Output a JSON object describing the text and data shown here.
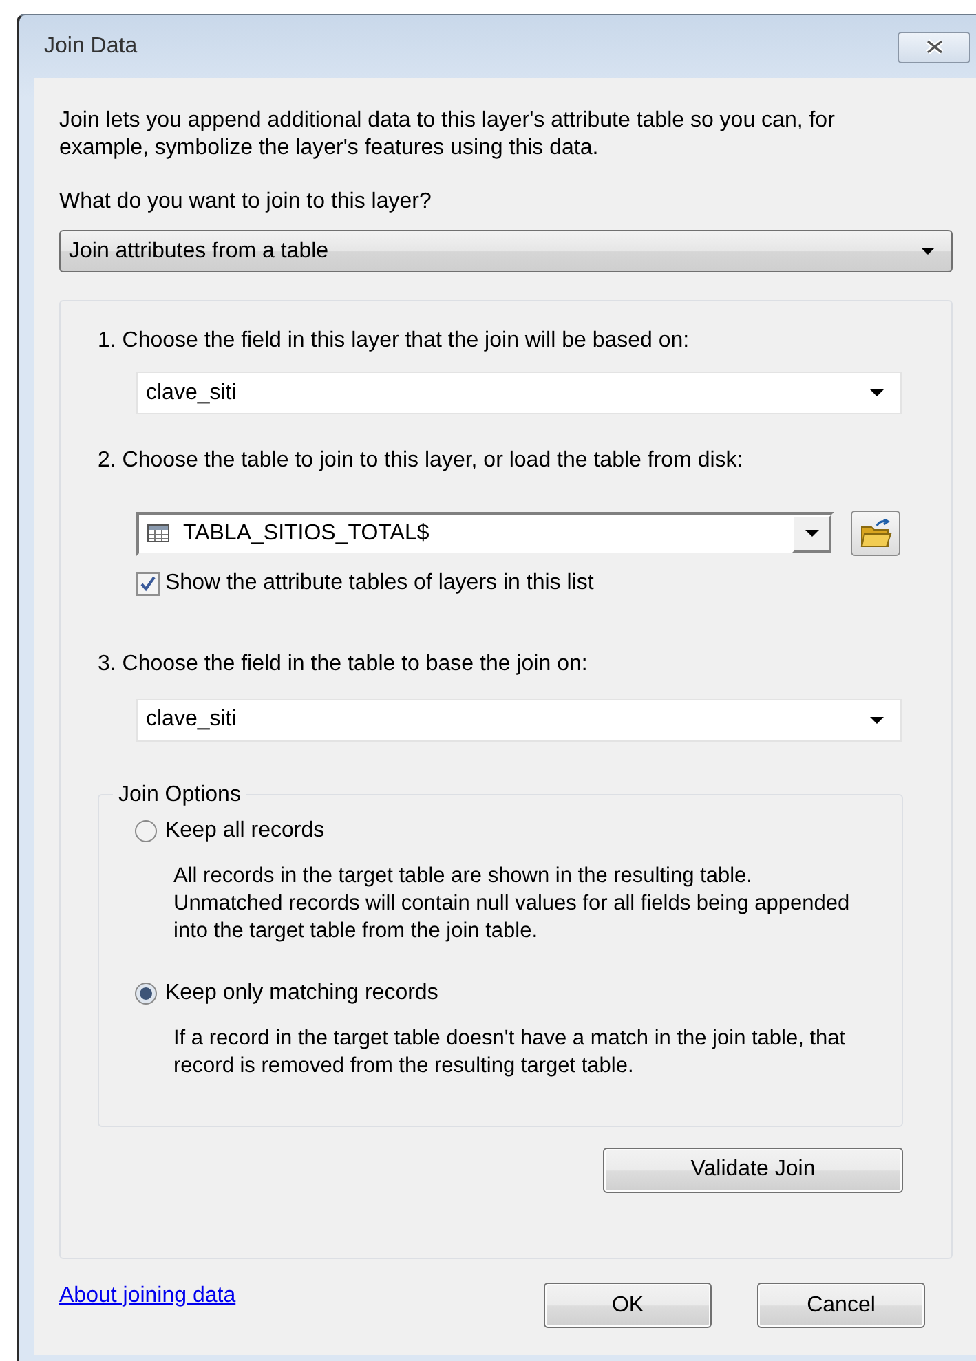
{
  "window": {
    "title": "Join Data"
  },
  "intro": "Join lets you append additional data to this layer's attribute table so you can, for example, symbolize the layer's features using this data.",
  "join_type": {
    "label": "What do you want to join to this layer?",
    "value": "Join attributes from a table"
  },
  "steps": [
    {
      "kind": "field",
      "label": "1. Choose the field in this layer that the join will be based on:",
      "value": "clave_siti"
    },
    {
      "kind": "table",
      "label": "2. Choose the table to join to this layer, or load the table from disk:",
      "value": "TABLA_SITIOS_TOTAL$",
      "checkbox": {
        "label": "Show the attribute tables of layers in this list",
        "checked": true
      }
    },
    {
      "kind": "field",
      "label": "3. Choose the field in the table to base the join on:",
      "value": "clave_siti"
    }
  ],
  "join_options": {
    "title": "Join Options",
    "options": [
      {
        "label": "Keep all records",
        "selected": false,
        "description": "All records in the target table are shown in the resulting table. Unmatched records will contain null values for all fields being appended into the target table from the join table."
      },
      {
        "label": "Keep only matching records",
        "selected": true,
        "description": "If a record in the target table doesn't have a match in the join table, that record is removed from the resulting target table."
      }
    ]
  },
  "validate_button": "Validate Join",
  "link": "About joining data",
  "buttons": [
    "OK",
    "Cancel"
  ]
}
